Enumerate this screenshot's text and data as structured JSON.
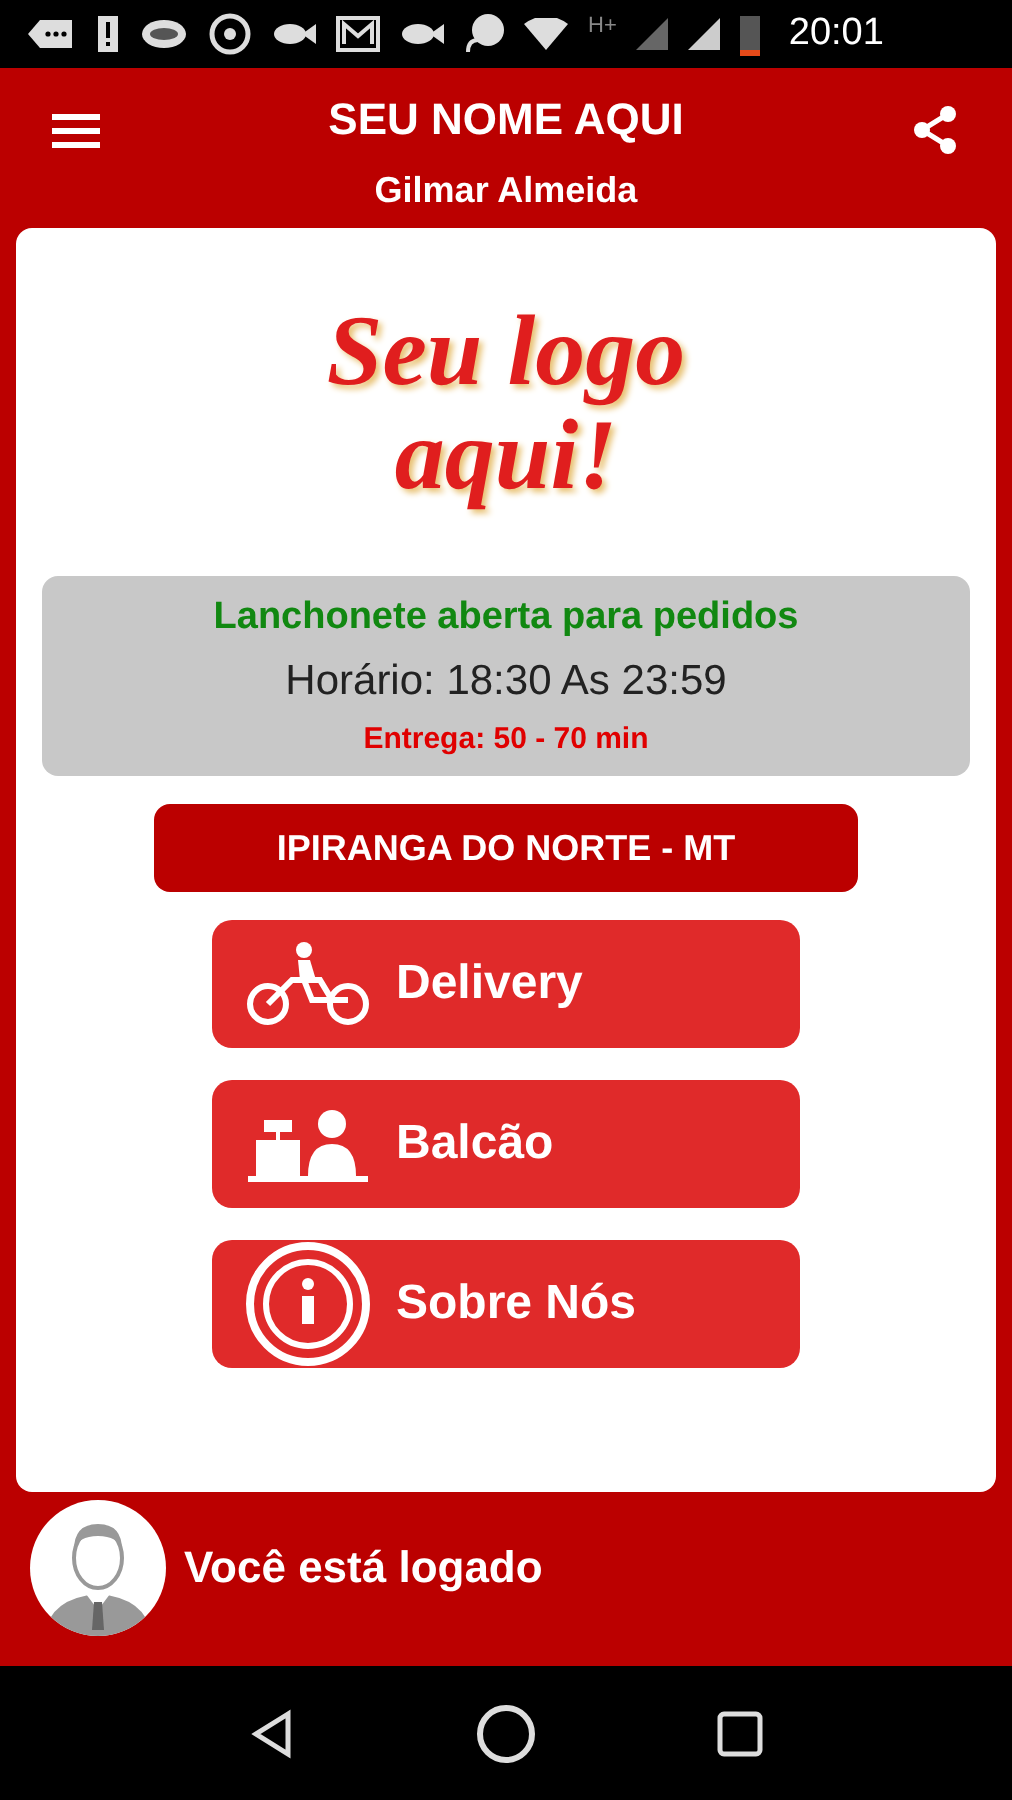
{
  "status_bar": {
    "network": "H+",
    "time": "20:01"
  },
  "header": {
    "title": "SEU NOME AQUI",
    "subtitle": "Gilmar Almeida"
  },
  "logo": {
    "lines": [
      "Seu logo",
      "aqui!"
    ]
  },
  "info": {
    "status": "Lanchonete aberta para pedidos",
    "hours": "Horário: 18:30 As 23:59",
    "delivery_time": "Entrega: 50 - 70 min"
  },
  "location": "IPIRANGA DO NORTE - MT",
  "buttons": [
    {
      "kind": "delivery",
      "label": "Delivery"
    },
    {
      "kind": "counter",
      "label": "Balcão"
    },
    {
      "kind": "info",
      "label": "Sobre Nós"
    }
  ],
  "footer": {
    "text": "Você está logado"
  }
}
